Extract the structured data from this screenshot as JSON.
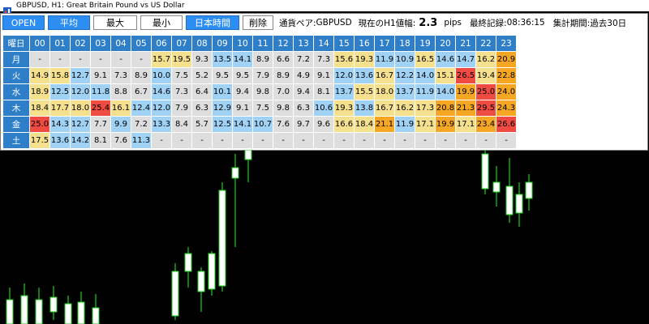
{
  "window": {
    "title": "GBPUSD, H1:  Great Britain Pound vs US Dollar"
  },
  "toolbar": {
    "buttons": [
      {
        "label": "OPEN",
        "active": true
      },
      {
        "label": "平均",
        "active": true
      },
      {
        "label": "最大",
        "active": false
      },
      {
        "label": "最小",
        "active": false
      },
      {
        "label": "日本時間",
        "active": true
      },
      {
        "label": "削除",
        "active": false
      }
    ],
    "pair_label": "通貨ペア:",
    "pair_value": "GBPUSD",
    "current_label": "現在のH1値幅:",
    "current_value": "2.3",
    "current_unit": "pips",
    "last_label": "最終記録:",
    "last_value": "08:36:15",
    "period_label": "集計期間:",
    "period_value": "過去30日"
  },
  "table": {
    "corner": "曜日",
    "hours": [
      "00",
      "01",
      "02",
      "03",
      "04",
      "05",
      "06",
      "07",
      "08",
      "09",
      "10",
      "11",
      "12",
      "13",
      "14",
      "15",
      "16",
      "17",
      "18",
      "19",
      "20",
      "21",
      "22",
      "23"
    ],
    "rows": [
      {
        "day": "月",
        "values": [
          "-",
          "-",
          "-",
          "-",
          "-",
          "-",
          "15.7",
          "19.5",
          "9.3",
          "13.5",
          "14.1",
          "8.9",
          "6.6",
          "7.2",
          "7.3",
          "15.6",
          "19.3",
          "11.9",
          "10.9",
          "16.5",
          "14.6",
          "14.7",
          "16.2",
          "20.9"
        ]
      },
      {
        "day": "火",
        "values": [
          "14.9",
          "15.8",
          "12.7",
          "9.1",
          "7.3",
          "8.9",
          "10.0",
          "7.5",
          "5.2",
          "9.5",
          "9.5",
          "7.9",
          "8.9",
          "4.9",
          "9.1",
          "12.0",
          "13.6",
          "16.7",
          "12.2",
          "14.0",
          "15.1",
          "26.5",
          "19.4",
          "22.8"
        ]
      },
      {
        "day": "水",
        "values": [
          "18.9",
          "12.5",
          "12.0",
          "11.8",
          "8.8",
          "6.7",
          "14.6",
          "7.3",
          "6.4",
          "10.1",
          "9.4",
          "9.8",
          "7.0",
          "9.4",
          "8.1",
          "13.7",
          "15.5",
          "18.0",
          "13.7",
          "11.9",
          "14.0",
          "19.9",
          "25.0",
          "24.0"
        ]
      },
      {
        "day": "木",
        "values": [
          "18.4",
          "17.7",
          "18.0",
          "25.4",
          "16.1",
          "12.4",
          "12.0",
          "7.9",
          "6.3",
          "12.9",
          "9.1",
          "7.5",
          "9.8",
          "6.3",
          "10.6",
          "19.3",
          "13.8",
          "16.7",
          "16.2",
          "17.3",
          "20.8",
          "21.3",
          "29.5",
          "24.3"
        ]
      },
      {
        "day": "金",
        "values": [
          "25.0",
          "14.3",
          "12.7",
          "7.7",
          "9.9",
          "7.2",
          "13.3",
          "8.4",
          "5.7",
          "12.5",
          "14.1",
          "10.7",
          "7.6",
          "9.7",
          "9.6",
          "16.6",
          "18.4",
          "21.1",
          "11.9",
          "17.1",
          "19.9",
          "17.1",
          "23.4",
          "26.6"
        ]
      },
      {
        "day": "土",
        "values": [
          "17.5",
          "13.6",
          "14.2",
          "8.1",
          "7.6",
          "11.3",
          "-",
          "-",
          "-",
          "-",
          "-",
          "-",
          "-",
          "-",
          "-",
          "-",
          "-",
          "-",
          "-",
          "-",
          "-",
          "-",
          "-",
          "-"
        ]
      }
    ]
  },
  "colors": {
    "header": "#2f7ec8",
    "day_header": "#2f7ec8",
    "cell_default": "#dedede",
    "cell_yellow": "#f5e08e",
    "cell_orange": "#f5a623",
    "cell_red": "#ef4b43",
    "cell_blue": "#9fd2f5",
    "button_active": "#2c8ef2",
    "candle_up": "#ffffff",
    "candle_wick": "#19d219",
    "background": "#000000"
  }
}
